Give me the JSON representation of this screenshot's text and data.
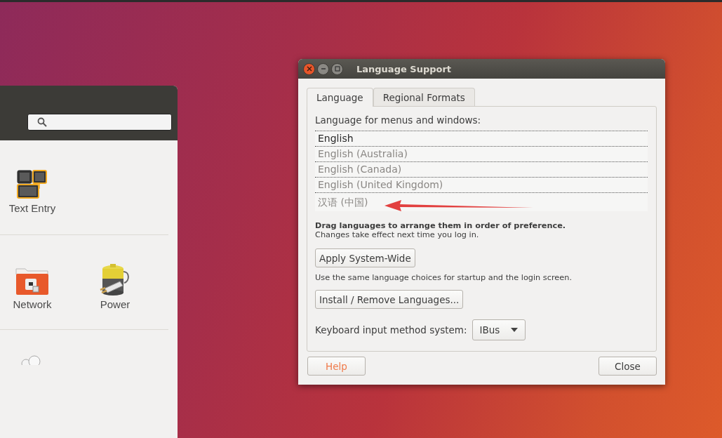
{
  "settings_window": {
    "sections": [
      {
        "items": [
          {
            "label": "Text Entry"
          }
        ]
      },
      {
        "items": [
          {
            "label": "Network"
          },
          {
            "label": "Power"
          }
        ]
      }
    ]
  },
  "dialog": {
    "title": "Language Support",
    "tabs": [
      {
        "label": "Language",
        "selected": true
      },
      {
        "label": "Regional Formats",
        "selected": false
      }
    ],
    "list_label": "Language for menus and windows:",
    "languages": [
      {
        "label": "English",
        "active": true
      },
      {
        "label": "English (Australia)",
        "active": false
      },
      {
        "label": "English (Canada)",
        "active": false
      },
      {
        "label": "English (United Kingdom)",
        "active": false
      },
      {
        "label": "汉语 (中国)",
        "active": false
      }
    ],
    "drag_hint": "Drag languages to arrange them in order of preference.",
    "effect_hint": "Changes take effect next time you log in.",
    "apply_button": "Apply System-Wide",
    "apply_hint": "Use the same language choices for startup and the login screen.",
    "install_button": "Install / Remove Languages...",
    "input_method_label": "Keyboard input method system:",
    "input_method": "IBus",
    "help_button": "Help",
    "close_button": "Close"
  }
}
